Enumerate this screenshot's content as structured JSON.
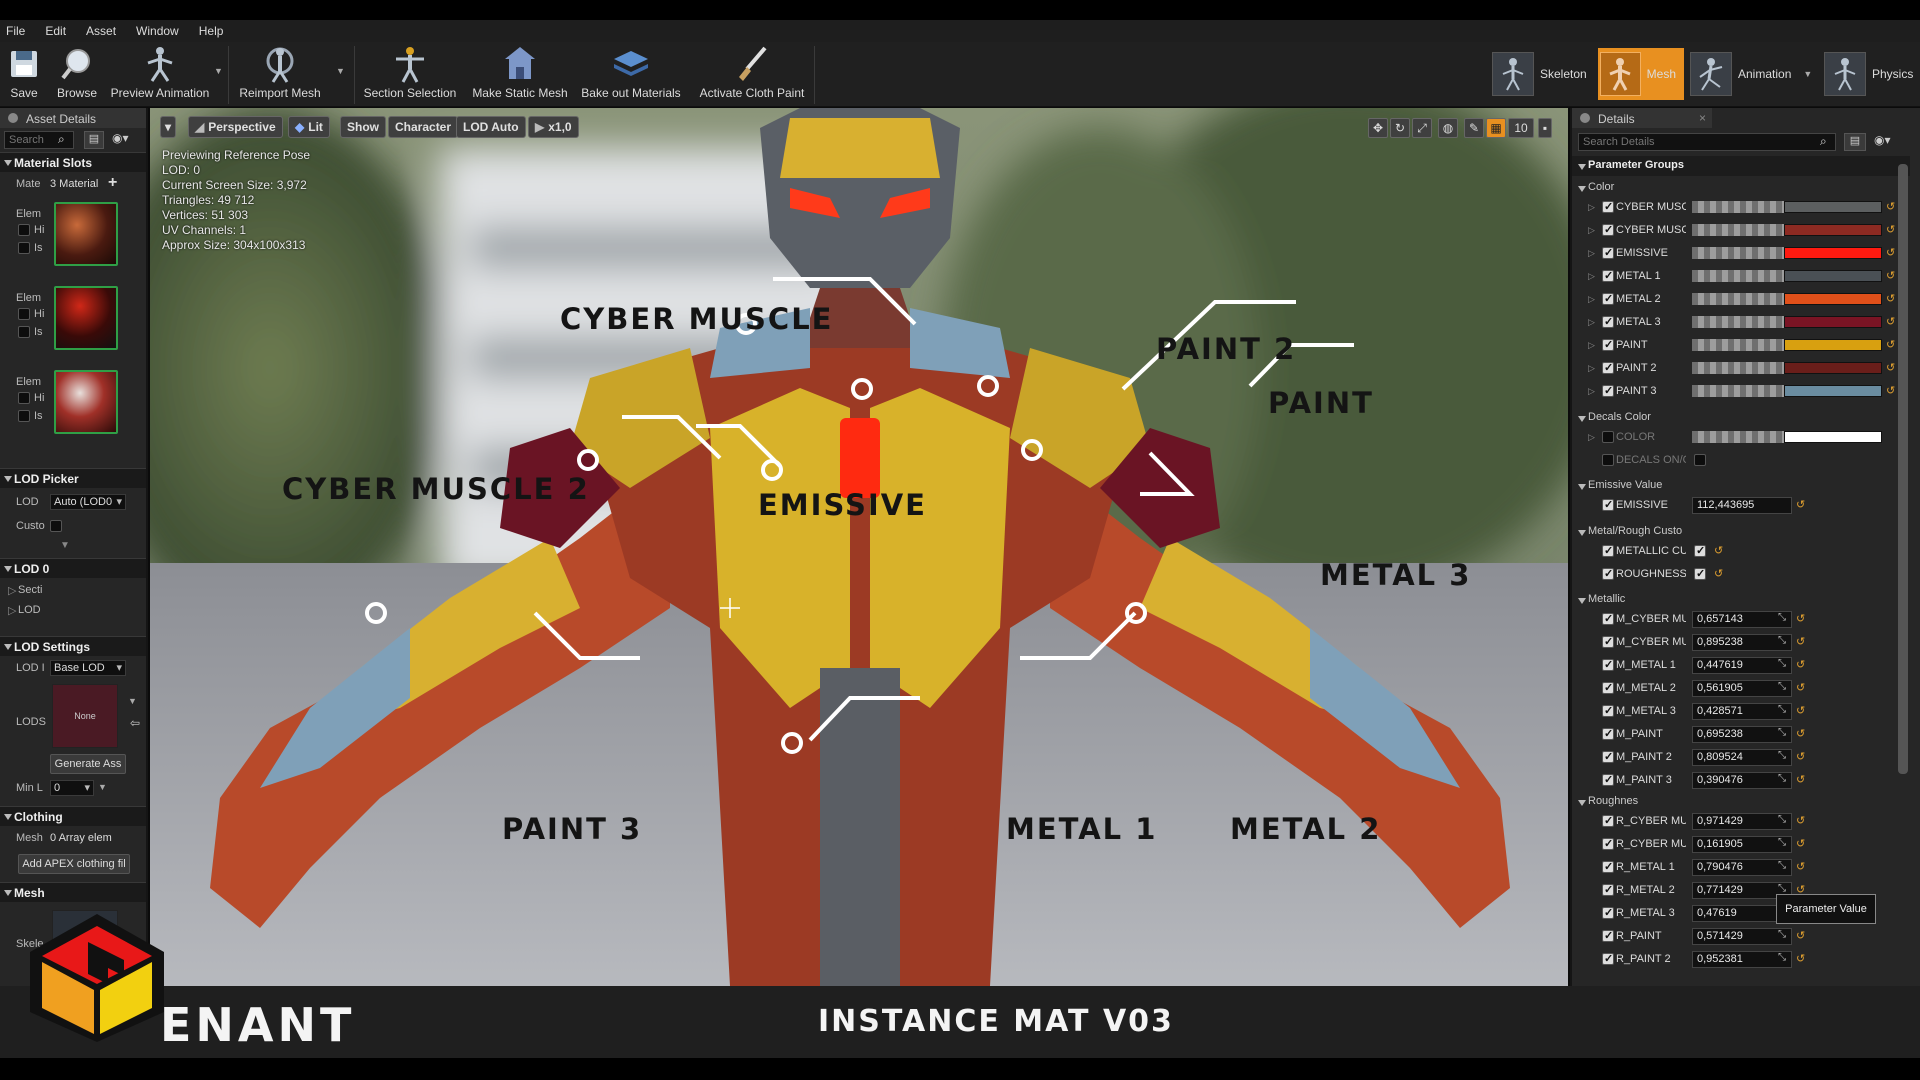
{
  "menu": [
    "File",
    "Edit",
    "Asset",
    "Window",
    "Help"
  ],
  "toolbar": {
    "buttons": [
      {
        "label": "Save",
        "icon": "save-icon"
      },
      {
        "label": "Browse",
        "icon": "browse-icon"
      },
      {
        "label": "Preview Animation",
        "icon": "preview-animation-icon"
      },
      {
        "label": "Reimport Mesh",
        "icon": "reimport-mesh-icon"
      },
      {
        "label": "Section Selection",
        "icon": "section-selection-icon"
      },
      {
        "label": "Make Static Mesh",
        "icon": "make-static-mesh-icon"
      },
      {
        "label": "Bake out Materials",
        "icon": "bake-materials-icon"
      },
      {
        "label": "Activate Cloth Paint",
        "icon": "cloth-paint-icon"
      }
    ],
    "modes": [
      {
        "label": "Skeleton",
        "active": false
      },
      {
        "label": "Mesh",
        "active": true
      },
      {
        "label": "Animation",
        "active": false
      },
      {
        "label": "Physics",
        "active": false
      }
    ],
    "accent": "#e89020"
  },
  "left_panel": {
    "tab": "Asset Details",
    "search_placeholder": "Search",
    "material_slots": {
      "title": "Material Slots",
      "mate_label": "Mate",
      "count": "3 Material",
      "elements": [
        {
          "label": "Elem",
          "opt1": "Hi",
          "opt2": "Is"
        },
        {
          "label": "Elem",
          "opt1": "Hi",
          "opt2": "Is"
        },
        {
          "label": "Elem",
          "opt1": "Hi",
          "opt2": "Is"
        }
      ]
    },
    "lod_picker": {
      "title": "LOD Picker",
      "lod_label": "LOD",
      "lod_value": "Auto (LOD0",
      "custom_label": "Custo"
    },
    "lod0": {
      "title": "LOD 0",
      "items": [
        "Secti",
        "LOD"
      ]
    },
    "lod_settings": {
      "title": "LOD Settings",
      "lod_label": "LOD I",
      "lod_value": "Base LOD",
      "lods_label": "LODS",
      "none_label": "None",
      "generate_button": "Generate Ass",
      "min_label": "Min L",
      "min_value": "0"
    },
    "clothing": {
      "title": "Clothing",
      "mesh_label": "Mesh",
      "array_value": "0 Array elem",
      "add_button": "Add APEX clothing fil"
    },
    "mesh": {
      "title": "Mesh",
      "skele_label": "Skele"
    }
  },
  "viewport": {
    "buttons": [
      "Perspective",
      "Lit",
      "Show",
      "Character",
      "LOD Auto",
      "x1,0"
    ],
    "grid_value": "10",
    "info": [
      "Previewing Reference Pose",
      "LOD: 0",
      "Current Screen Size: 3,972",
      "Triangles: 49 712",
      "Vertices: 51 303",
      "UV Channels: 1",
      "Approx Size: 304x100x313"
    ],
    "callouts": [
      "CYBER MUSCLE",
      "PAINT 2",
      "PAINT",
      "CYBER MUSCLE 2",
      "EMISSIVE",
      "METAL 3",
      "PAINT 3",
      "METAL 1",
      "METAL 2"
    ]
  },
  "details": {
    "tab": "Details",
    "search_placeholder": "Search Details",
    "parameter_groups": "Parameter Groups",
    "color_section": "Color",
    "colors": [
      {
        "name": "CYBER MUSCL",
        "color": "#5c5f60"
      },
      {
        "name": "CYBER MUSCI",
        "color": "#8c2a22"
      },
      {
        "name": "EMISSIVE",
        "color": "#ff1a10"
      },
      {
        "name": "METAL 1",
        "color": "#4a5055"
      },
      {
        "name": "METAL 2",
        "color": "#e0501a"
      },
      {
        "name": "METAL 3",
        "color": "#7a1424"
      },
      {
        "name": "PAINT",
        "color": "#d8a010"
      },
      {
        "name": "PAINT 2",
        "color": "#6a1e1a"
      },
      {
        "name": "PAINT 3",
        "color": "#6a8ca0"
      }
    ],
    "decals_section": "Decals Color",
    "decals": [
      {
        "name": "COLOR",
        "color": "#ffffff"
      },
      {
        "name": "DECALS ON/O"
      }
    ],
    "emissive_section": "Emissive Value",
    "emissive": {
      "name": "EMISSIVE",
      "value": "112,443695"
    },
    "metal_rough_section": "Metal/Rough Custo",
    "metal_rough": [
      {
        "name": "METALLIC CUS"
      },
      {
        "name": "ROUGHNESS C"
      }
    ],
    "metallic_section": "Metallic",
    "metallic": [
      {
        "name": "M_CYBER MUS",
        "value": "0,657143"
      },
      {
        "name": "M_CYBER MUS",
        "value": "0,895238"
      },
      {
        "name": "M_METAL 1",
        "value": "0,447619"
      },
      {
        "name": "M_METAL 2",
        "value": "0,561905"
      },
      {
        "name": "M_METAL 3",
        "value": "0,428571"
      },
      {
        "name": "M_PAINT",
        "value": "0,695238"
      },
      {
        "name": "M_PAINT 2",
        "value": "0,809524"
      },
      {
        "name": "M_PAINT 3",
        "value": "0,390476"
      }
    ],
    "rough_section": "Roughnes",
    "roughness": [
      {
        "name": "R_CYBER MUS",
        "value": "0,971429"
      },
      {
        "name": "R_CYBER MUS",
        "value": "0,161905"
      },
      {
        "name": "R_METAL 1",
        "value": "0,790476"
      },
      {
        "name": "R_METAL 2",
        "value": "0,771429"
      },
      {
        "name": "R_METAL 3",
        "value": "0,47619"
      },
      {
        "name": "R_PAINT",
        "value": "0,571429"
      },
      {
        "name": "R_PAINT 2",
        "value": "0,952381"
      }
    ],
    "tooltip": "Parameter Value"
  },
  "footer": {
    "brand": "ENANT",
    "title": "INSTANCE MAT V03"
  }
}
